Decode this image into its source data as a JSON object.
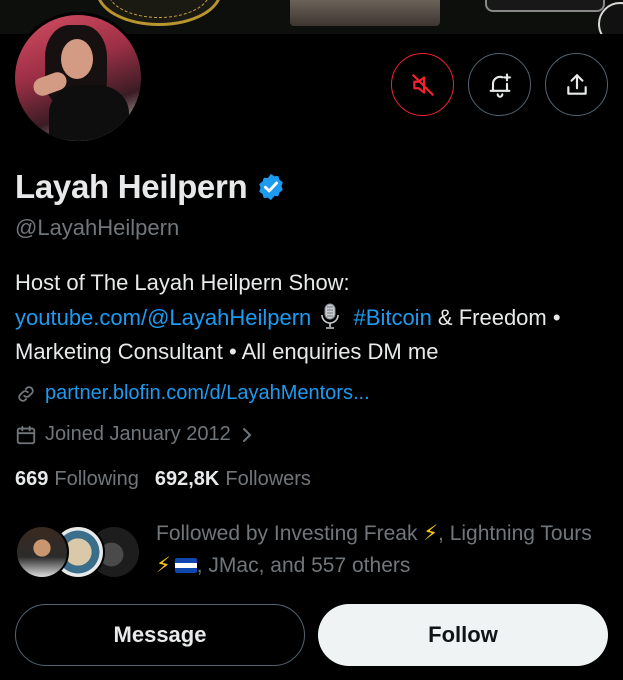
{
  "profile": {
    "name": "Layah Heilpern",
    "handle": "@LayahHeilpern",
    "bio": {
      "prefix": "Host of The Layah Heilpern Show: ",
      "link": "youtube.com/@LayahHeilpern",
      "hashtag": "#Bitcoin",
      "after_hashtag": " & Freedom •",
      "line3": "Marketing Consultant • All enquiries DM me"
    },
    "website": "partner.blofin.com/d/LayahMentors...",
    "joined": "Joined January 2012",
    "following_count": "669",
    "following_label": "Following",
    "followers_count": "692,8K",
    "followers_label": "Followers"
  },
  "followed_by": {
    "part1": "Followed by Investing Freak ",
    "bolt": "⚡",
    "part2": ", Lightning Tours ",
    "part3": ", JMac, and 557 others"
  },
  "actions": {
    "mute_icon": "muted-notifications-icon",
    "subscribe_icon": "bell-plus-icon",
    "share_icon": "share-icon",
    "message_label": "Message",
    "follow_label": "Follow"
  },
  "colors": {
    "accent": "#1d9bf0",
    "muted_red": "#f4212e",
    "secondary_text": "#71767b"
  }
}
